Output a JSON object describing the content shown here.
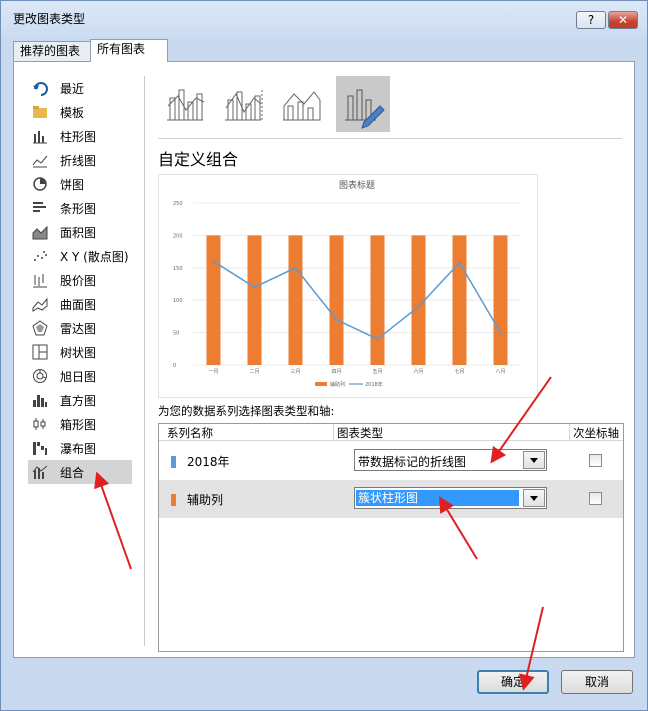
{
  "window": {
    "title": "更改图表类型",
    "help": "?",
    "close": "✕"
  },
  "tabs": [
    {
      "label": "推荐的图表"
    },
    {
      "label": "所有图表"
    }
  ],
  "nav": {
    "items": [
      {
        "label": "最近",
        "icon": "recent-icon"
      },
      {
        "label": "模板",
        "icon": "folder-icon"
      },
      {
        "label": "柱形图",
        "icon": "column-chart-icon"
      },
      {
        "label": "折线图",
        "icon": "line-chart-icon"
      },
      {
        "label": "饼图",
        "icon": "pie-chart-icon"
      },
      {
        "label": "条形图",
        "icon": "bar-chart-icon"
      },
      {
        "label": "面积图",
        "icon": "area-chart-icon"
      },
      {
        "label": "X Y (散点图)",
        "icon": "scatter-chart-icon"
      },
      {
        "label": "股价图",
        "icon": "stock-chart-icon"
      },
      {
        "label": "曲面图",
        "icon": "surface-chart-icon"
      },
      {
        "label": "雷达图",
        "icon": "radar-chart-icon"
      },
      {
        "label": "树状图",
        "icon": "treemap-chart-icon"
      },
      {
        "label": "旭日图",
        "icon": "sunburst-chart-icon"
      },
      {
        "label": "直方图",
        "icon": "histogram-chart-icon"
      },
      {
        "label": "箱形图",
        "icon": "box-chart-icon"
      },
      {
        "label": "瀑布图",
        "icon": "waterfall-chart-icon"
      },
      {
        "label": "组合",
        "icon": "combo-chart-icon"
      }
    ],
    "selected": "组合"
  },
  "heading": "自定义组合",
  "chart_data": {
    "type": "bar",
    "title": "图表标题",
    "categories": [
      "一月",
      "二月",
      "三月",
      "四月",
      "五月",
      "六月",
      "七月",
      "八月"
    ],
    "series": [
      {
        "name": "辅助列",
        "kind": "bar",
        "color": "#ed7d31",
        "values": [
          200,
          200,
          200,
          200,
          200,
          200,
          200,
          200
        ]
      },
      {
        "name": "2018年",
        "kind": "line",
        "color": "#5b9bd5",
        "values": [
          160,
          120,
          150,
          70,
          40,
          90,
          158,
          50
        ]
      }
    ],
    "y_ticks": [
      "0",
      "50",
      "100",
      "150",
      "200",
      "250"
    ],
    "ylim": [
      0,
      250
    ],
    "grid": true,
    "legend": "bottom"
  },
  "series_prompt": "为您的数据系列选择图表类型和轴:",
  "grid": {
    "headers": {
      "name": "系列名称",
      "type": "图表类型",
      "secondary": "次坐标轴"
    },
    "rows": [
      {
        "name": "2018年",
        "color": "#5b9bd5",
        "type": "带数据标记的折线图"
      },
      {
        "name": "辅助列",
        "color": "#ed7d31",
        "type": "簇状柱形图"
      }
    ]
  },
  "buttons": {
    "ok": "确定",
    "cancel": "取消"
  }
}
